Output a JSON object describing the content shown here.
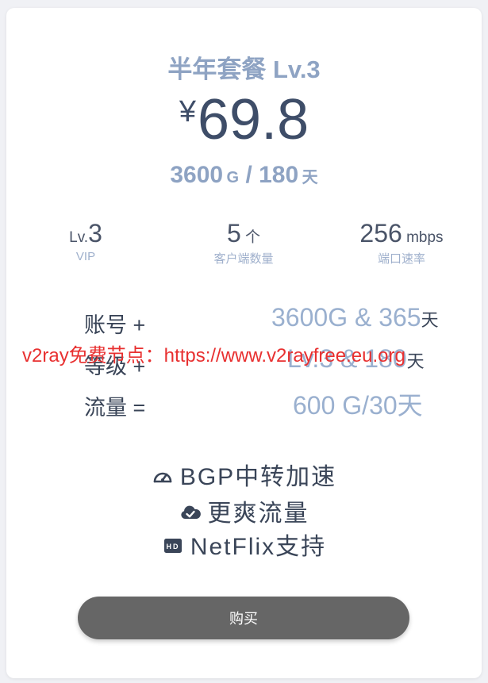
{
  "plan": {
    "title": "半年套餐 Lv.3",
    "currency": "¥",
    "price": "69.8",
    "traffic_amount": "3600",
    "traffic_unit": "G",
    "separator": " / ",
    "days": "180",
    "days_unit": "天"
  },
  "stats": [
    {
      "prefix": "Lv.",
      "value": "3",
      "unit": "",
      "label": "VIP"
    },
    {
      "prefix": "",
      "value": "5",
      "unit": " 个",
      "label": "客户端数量"
    },
    {
      "prefix": "",
      "value": "256",
      "unit": " mbps",
      "label": "端口速率"
    }
  ],
  "formula": [
    {
      "label": "账号 +",
      "value": "3600G & 365",
      "unit": "天"
    },
    {
      "label": "等级 +",
      "value": "Lv.3 & 180",
      "unit": "天"
    },
    {
      "label": "流量 =",
      "value": "600 G/30天",
      "unit": ""
    }
  ],
  "watermark": "v2ray免费节点：https://www.v2rayfree.eu.org",
  "features": [
    {
      "icon": "speedometer-icon",
      "text": "BGP中转加速"
    },
    {
      "icon": "cloud-check-icon",
      "text": "更爽流量"
    },
    {
      "icon": "hd-icon",
      "text": "NetFlix支持"
    }
  ],
  "buy_label": "购买",
  "colors": {
    "accent_light": "#8ea3c3",
    "price_dark": "#3e4d68",
    "watermark": "#e83030",
    "button": "#666666"
  }
}
